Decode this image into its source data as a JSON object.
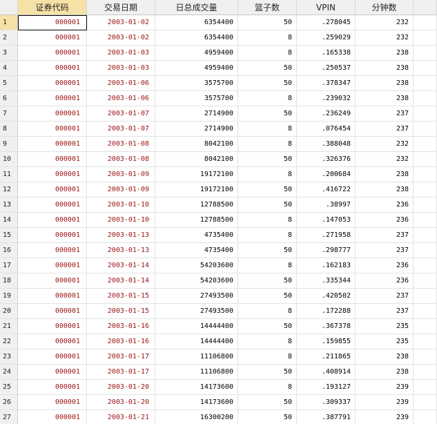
{
  "columns": [
    "证券代码",
    "交易日期",
    "日总成交量",
    "篮子数",
    "VPIN",
    "分钟数"
  ],
  "rows": [
    {
      "n": "1",
      "code": "000001",
      "date": "2003-01-02",
      "vol": "6354400",
      "basket": "50",
      "vpin": ".278045",
      "min": "232"
    },
    {
      "n": "2",
      "code": "000001",
      "date": "2003-01-02",
      "vol": "6354400",
      "basket": "8",
      "vpin": ".259029",
      "min": "232"
    },
    {
      "n": "3",
      "code": "000001",
      "date": "2003-01-03",
      "vol": "4959400",
      "basket": "8",
      "vpin": ".165338",
      "min": "238"
    },
    {
      "n": "4",
      "code": "000001",
      "date": "2003-01-03",
      "vol": "4959400",
      "basket": "50",
      "vpin": ".250537",
      "min": "238"
    },
    {
      "n": "5",
      "code": "000001",
      "date": "2003-01-06",
      "vol": "3575700",
      "basket": "50",
      "vpin": ".378347",
      "min": "238"
    },
    {
      "n": "6",
      "code": "000001",
      "date": "2003-01-06",
      "vol": "3575700",
      "basket": "8",
      "vpin": ".239032",
      "min": "238"
    },
    {
      "n": "7",
      "code": "000001",
      "date": "2003-01-07",
      "vol": "2714900",
      "basket": "50",
      "vpin": ".236249",
      "min": "237"
    },
    {
      "n": "8",
      "code": "000001",
      "date": "2003-01-07",
      "vol": "2714900",
      "basket": "8",
      "vpin": ".076454",
      "min": "237"
    },
    {
      "n": "9",
      "code": "000001",
      "date": "2003-01-08",
      "vol": "8042100",
      "basket": "8",
      "vpin": ".388048",
      "min": "232"
    },
    {
      "n": "10",
      "code": "000001",
      "date": "2003-01-08",
      "vol": "8042100",
      "basket": "50",
      "vpin": ".326376",
      "min": "232"
    },
    {
      "n": "11",
      "code": "000001",
      "date": "2003-01-09",
      "vol": "19172100",
      "basket": "8",
      "vpin": ".200684",
      "min": "238"
    },
    {
      "n": "12",
      "code": "000001",
      "date": "2003-01-09",
      "vol": "19172100",
      "basket": "50",
      "vpin": ".416722",
      "min": "238"
    },
    {
      "n": "13",
      "code": "000001",
      "date": "2003-01-10",
      "vol": "12788500",
      "basket": "50",
      "vpin": ".38997",
      "min": "236"
    },
    {
      "n": "14",
      "code": "000001",
      "date": "2003-01-10",
      "vol": "12788500",
      "basket": "8",
      "vpin": ".147053",
      "min": "236"
    },
    {
      "n": "15",
      "code": "000001",
      "date": "2003-01-13",
      "vol": "4735400",
      "basket": "8",
      "vpin": ".271958",
      "min": "237"
    },
    {
      "n": "16",
      "code": "000001",
      "date": "2003-01-13",
      "vol": "4735400",
      "basket": "50",
      "vpin": ".298777",
      "min": "237"
    },
    {
      "n": "17",
      "code": "000001",
      "date": "2003-01-14",
      "vol": "54203600",
      "basket": "8",
      "vpin": ".162183",
      "min": "236"
    },
    {
      "n": "18",
      "code": "000001",
      "date": "2003-01-14",
      "vol": "54203600",
      "basket": "50",
      "vpin": ".335344",
      "min": "236"
    },
    {
      "n": "19",
      "code": "000001",
      "date": "2003-01-15",
      "vol": "27493500",
      "basket": "50",
      "vpin": ".420502",
      "min": "237"
    },
    {
      "n": "20",
      "code": "000001",
      "date": "2003-01-15",
      "vol": "27493500",
      "basket": "8",
      "vpin": ".172288",
      "min": "237"
    },
    {
      "n": "21",
      "code": "000001",
      "date": "2003-01-16",
      "vol": "14444400",
      "basket": "50",
      "vpin": ".367378",
      "min": "235"
    },
    {
      "n": "22",
      "code": "000001",
      "date": "2003-01-16",
      "vol": "14444400",
      "basket": "8",
      "vpin": ".159855",
      "min": "235"
    },
    {
      "n": "23",
      "code": "000001",
      "date": "2003-01-17",
      "vol": "11106800",
      "basket": "8",
      "vpin": ".211865",
      "min": "238"
    },
    {
      "n": "24",
      "code": "000001",
      "date": "2003-01-17",
      "vol": "11106800",
      "basket": "50",
      "vpin": ".408914",
      "min": "238"
    },
    {
      "n": "25",
      "code": "000001",
      "date": "2003-01-20",
      "vol": "14173600",
      "basket": "8",
      "vpin": ".193127",
      "min": "239"
    },
    {
      "n": "26",
      "code": "000001",
      "date": "2003-01-20",
      "vol": "14173600",
      "basket": "50",
      "vpin": ".309337",
      "min": "239"
    },
    {
      "n": "27",
      "code": "000001",
      "date": "2003-01-21",
      "vol": "16300200",
      "basket": "50",
      "vpin": ".387791",
      "min": "239"
    }
  ],
  "colors": {
    "string_text": "#9a1212",
    "selected_header": "#f6e2a6",
    "header_bg": "#f0f0f0",
    "grid_line": "#e2e2e2"
  }
}
